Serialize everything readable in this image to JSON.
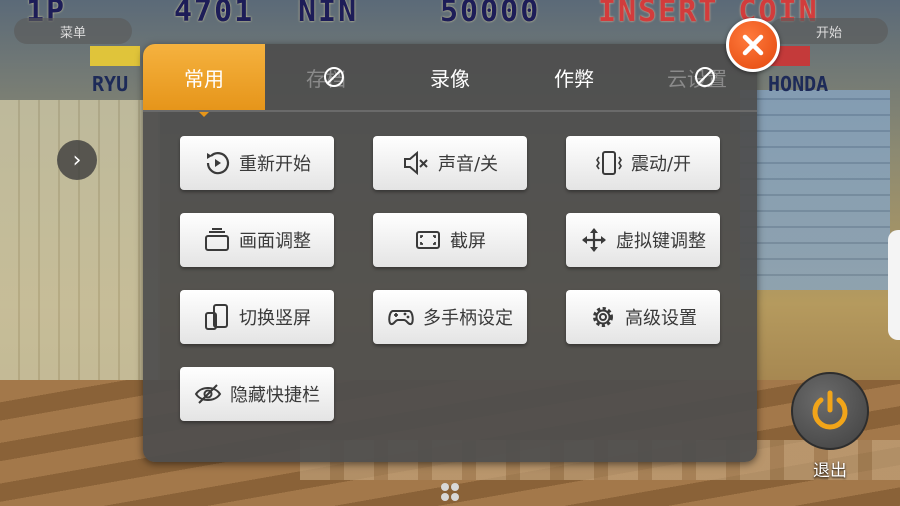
{
  "background": {
    "hud": {
      "player_label": "1P",
      "player_score": "4701",
      "player_code": "NIN",
      "hi_score": "50000",
      "insert_coin": "INSERT COIN",
      "left_pill": "菜单",
      "right_pill": "开始",
      "left_name": "RYU",
      "right_name": "HONDA"
    }
  },
  "dialog": {
    "tabs": [
      {
        "label": "常用",
        "state": "active"
      },
      {
        "label": "存档",
        "state": "disabled"
      },
      {
        "label": "录像",
        "state": "normal"
      },
      {
        "label": "作弊",
        "state": "normal"
      },
      {
        "label": "云设置",
        "state": "disabled"
      }
    ],
    "buttons": [
      {
        "label": "重新开始",
        "icon": "restart-icon"
      },
      {
        "label": "声音/关",
        "icon": "sound-off-icon"
      },
      {
        "label": "震动/开",
        "icon": "vibrate-icon"
      },
      {
        "label": "画面调整",
        "icon": "screen-adjust-icon"
      },
      {
        "label": "截屏",
        "icon": "screenshot-icon"
      },
      {
        "label": "虚拟键调整",
        "icon": "move-arrows-icon"
      },
      {
        "label": "切换竖屏",
        "icon": "rotate-portrait-icon"
      },
      {
        "label": "多手柄设定",
        "icon": "gamepad-icon"
      },
      {
        "label": "高级设置",
        "icon": "gear-icon"
      },
      {
        "label": "隐藏快捷栏",
        "icon": "eye-hidden-icon"
      }
    ],
    "close_icon": "close-icon"
  },
  "exit": {
    "label": "退出",
    "icon": "power-icon"
  },
  "colors": {
    "accent_orange": "#e6951a",
    "close_red": "#e3480e",
    "exit_power": "#f2a519",
    "dialog_bg": "#4e4e4e"
  }
}
